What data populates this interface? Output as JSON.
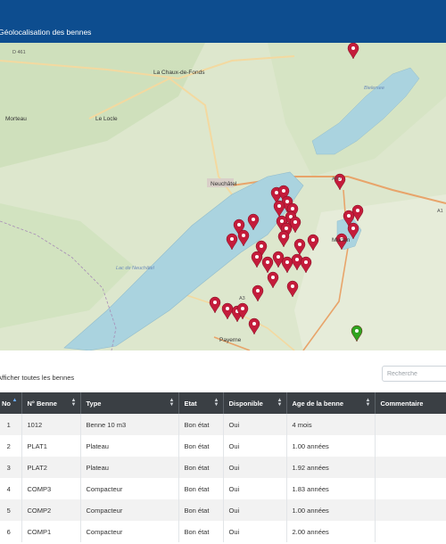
{
  "header": {
    "title": "Géolocalisation des bennes"
  },
  "map": {
    "labels": {
      "d461": "D 461",
      "la_chaux_de_fonds": "La Chaux-de-Fonds",
      "le_locle": "Le Locle",
      "morteau": "Morteau",
      "neuchatel": "Neuchâtel",
      "lac_de_neuchatel": "Lac de Neuchâtel",
      "murten": "Murten",
      "payerne": "Payerne",
      "bieler": "Bielersee",
      "a20": "A20",
      "a1": "A1",
      "a3": "A3"
    },
    "marker_colors": {
      "red": "#c41c3b",
      "green": "#2fa31f"
    }
  },
  "controls": {
    "show_all_label": "Afficher toutes les bennes",
    "search_placeholder": "Recherche"
  },
  "table": {
    "columns": [
      "No",
      "N° Benne",
      "Type",
      "Etat",
      "Disponible",
      "Age de la benne",
      "Commentaire"
    ],
    "rows": [
      [
        "1",
        "1012",
        "Benne 10 m3",
        "Bon état",
        "Oui",
        "4 mois",
        ""
      ],
      [
        "2",
        "PLAT1",
        "Plateau",
        "Bon état",
        "Oui",
        "1.00 années",
        ""
      ],
      [
        "3",
        "PLAT2",
        "Plateau",
        "Bon état",
        "Oui",
        "1.92 années",
        ""
      ],
      [
        "4",
        "COMP3",
        "Compacteur",
        "Bon état",
        "Oui",
        "1.83 années",
        ""
      ],
      [
        "5",
        "COMP2",
        "Compacteur",
        "Bon état",
        "Oui",
        "1.00 années",
        ""
      ],
      [
        "6",
        "COMP1",
        "Compacteur",
        "Bon état",
        "Oui",
        "2.00 années",
        ""
      ]
    ]
  }
}
